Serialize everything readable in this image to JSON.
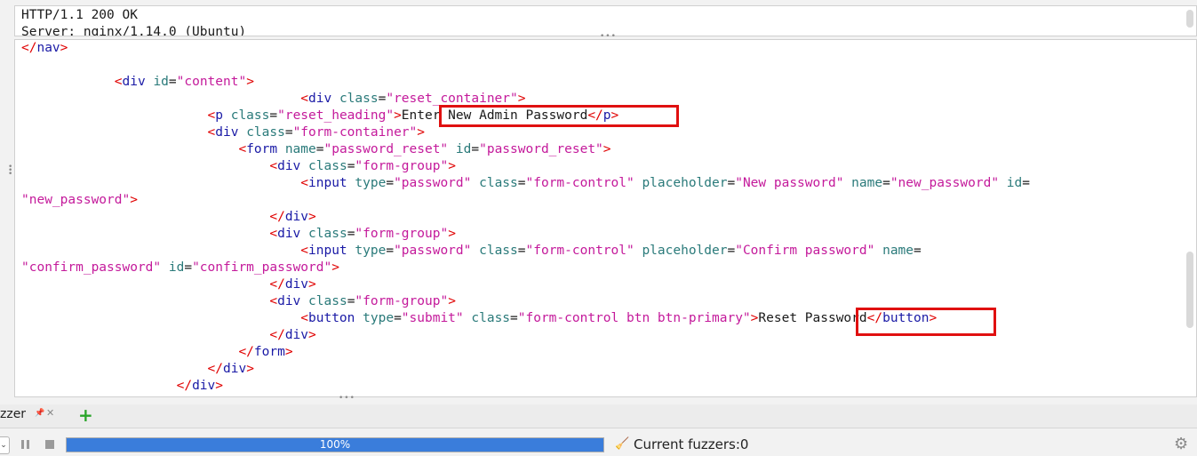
{
  "header": {
    "lines": [
      "HTTP/1.1 200 OK",
      "Server: nginx/1.14.0 (Ubuntu)"
    ]
  },
  "code": {
    "lines": [
      [
        [
          "bracket",
          "</"
        ],
        [
          "tag",
          "nav"
        ],
        [
          "bracket",
          ">"
        ]
      ],
      [],
      [
        [
          "txt",
          "            "
        ],
        [
          "bracket",
          "<"
        ],
        [
          "tag",
          "div"
        ],
        [
          "txt",
          " "
        ],
        [
          "attr",
          "id"
        ],
        [
          "txt",
          "="
        ],
        [
          "str",
          "\"content\""
        ],
        [
          "bracket",
          ">"
        ]
      ],
      [
        [
          "txt",
          "                                    "
        ],
        [
          "bracket",
          "<"
        ],
        [
          "tag",
          "div"
        ],
        [
          "txt",
          " "
        ],
        [
          "attr",
          "class"
        ],
        [
          "txt",
          "="
        ],
        [
          "str",
          "\"reset_container\""
        ],
        [
          "bracket",
          ">"
        ]
      ],
      [
        [
          "txt",
          "                        "
        ],
        [
          "bracket",
          "<"
        ],
        [
          "tag",
          "p"
        ],
        [
          "txt",
          " "
        ],
        [
          "attr",
          "class"
        ],
        [
          "txt",
          "="
        ],
        [
          "str",
          "\"reset_heading\""
        ],
        [
          "bracket",
          ">"
        ],
        [
          "txt",
          "Enter New Admin Password"
        ],
        [
          "bracket",
          "</"
        ],
        [
          "tag",
          "p"
        ],
        [
          "bracket",
          ">"
        ]
      ],
      [
        [
          "txt",
          "                        "
        ],
        [
          "bracket",
          "<"
        ],
        [
          "tag",
          "div"
        ],
        [
          "txt",
          " "
        ],
        [
          "attr",
          "class"
        ],
        [
          "txt",
          "="
        ],
        [
          "str",
          "\"form-container\""
        ],
        [
          "bracket",
          ">"
        ]
      ],
      [
        [
          "txt",
          "                            "
        ],
        [
          "bracket",
          "<"
        ],
        [
          "tag",
          "form"
        ],
        [
          "txt",
          " "
        ],
        [
          "attr",
          "name"
        ],
        [
          "txt",
          "="
        ],
        [
          "str",
          "\"password_reset\""
        ],
        [
          "txt",
          " "
        ],
        [
          "attr",
          "id"
        ],
        [
          "txt",
          "="
        ],
        [
          "str",
          "\"password_reset\""
        ],
        [
          "bracket",
          ">"
        ]
      ],
      [
        [
          "txt",
          "                                "
        ],
        [
          "bracket",
          "<"
        ],
        [
          "tag",
          "div"
        ],
        [
          "txt",
          " "
        ],
        [
          "attr",
          "class"
        ],
        [
          "txt",
          "="
        ],
        [
          "str",
          "\"form-group\""
        ],
        [
          "bracket",
          ">"
        ]
      ],
      [
        [
          "txt",
          "                                    "
        ],
        [
          "bracket",
          "<"
        ],
        [
          "tag",
          "input"
        ],
        [
          "txt",
          " "
        ],
        [
          "attr",
          "type"
        ],
        [
          "txt",
          "="
        ],
        [
          "str",
          "\"password\""
        ],
        [
          "txt",
          " "
        ],
        [
          "attr",
          "class"
        ],
        [
          "txt",
          "="
        ],
        [
          "str",
          "\"form-control\""
        ],
        [
          "txt",
          " "
        ],
        [
          "attr",
          "placeholder"
        ],
        [
          "txt",
          "="
        ],
        [
          "str",
          "\"New password\""
        ],
        [
          "txt",
          " "
        ],
        [
          "attr",
          "name"
        ],
        [
          "txt",
          "="
        ],
        [
          "str",
          "\"new_password\""
        ],
        [
          "txt",
          " "
        ],
        [
          "attr",
          "id"
        ],
        [
          "txt",
          "="
        ]
      ],
      [
        [
          "str",
          "\"new_password\""
        ],
        [
          "bracket",
          ">"
        ]
      ],
      [
        [
          "txt",
          "                                "
        ],
        [
          "bracket",
          "</"
        ],
        [
          "tag",
          "div"
        ],
        [
          "bracket",
          ">"
        ]
      ],
      [
        [
          "txt",
          "                                "
        ],
        [
          "bracket",
          "<"
        ],
        [
          "tag",
          "div"
        ],
        [
          "txt",
          " "
        ],
        [
          "attr",
          "class"
        ],
        [
          "txt",
          "="
        ],
        [
          "str",
          "\"form-group\""
        ],
        [
          "bracket",
          ">"
        ]
      ],
      [
        [
          "txt",
          "                                    "
        ],
        [
          "bracket",
          "<"
        ],
        [
          "tag",
          "input"
        ],
        [
          "txt",
          " "
        ],
        [
          "attr",
          "type"
        ],
        [
          "txt",
          "="
        ],
        [
          "str",
          "\"password\""
        ],
        [
          "txt",
          " "
        ],
        [
          "attr",
          "class"
        ],
        [
          "txt",
          "="
        ],
        [
          "str",
          "\"form-control\""
        ],
        [
          "txt",
          " "
        ],
        [
          "attr",
          "placeholder"
        ],
        [
          "txt",
          "="
        ],
        [
          "str",
          "\"Confirm password\""
        ],
        [
          "txt",
          " "
        ],
        [
          "attr",
          "name"
        ],
        [
          "txt",
          "="
        ]
      ],
      [
        [
          "str",
          "\"confirm_password\""
        ],
        [
          "txt",
          " "
        ],
        [
          "attr",
          "id"
        ],
        [
          "txt",
          "="
        ],
        [
          "str",
          "\"confirm_password\""
        ],
        [
          "bracket",
          ">"
        ]
      ],
      [
        [
          "txt",
          "                                "
        ],
        [
          "bracket",
          "</"
        ],
        [
          "tag",
          "div"
        ],
        [
          "bracket",
          ">"
        ]
      ],
      [
        [
          "txt",
          "                                "
        ],
        [
          "bracket",
          "<"
        ],
        [
          "tag",
          "div"
        ],
        [
          "txt",
          " "
        ],
        [
          "attr",
          "class"
        ],
        [
          "txt",
          "="
        ],
        [
          "str",
          "\"form-group\""
        ],
        [
          "bracket",
          ">"
        ]
      ],
      [
        [
          "txt",
          "                                    "
        ],
        [
          "bracket",
          "<"
        ],
        [
          "tag",
          "button"
        ],
        [
          "txt",
          " "
        ],
        [
          "attr",
          "type"
        ],
        [
          "txt",
          "="
        ],
        [
          "str",
          "\"submit\""
        ],
        [
          "txt",
          " "
        ],
        [
          "attr",
          "class"
        ],
        [
          "txt",
          "="
        ],
        [
          "str",
          "\"form-control btn btn-primary\""
        ],
        [
          "bracket",
          ">"
        ],
        [
          "txt",
          "Reset Password"
        ],
        [
          "bracket",
          "</"
        ],
        [
          "tag",
          "button"
        ],
        [
          "bracket",
          ">"
        ]
      ],
      [
        [
          "txt",
          "                                "
        ],
        [
          "bracket",
          "</"
        ],
        [
          "tag",
          "div"
        ],
        [
          "bracket",
          ">"
        ]
      ],
      [
        [
          "txt",
          "                            "
        ],
        [
          "bracket",
          "</"
        ],
        [
          "tag",
          "form"
        ],
        [
          "bracket",
          ">"
        ]
      ],
      [
        [
          "txt",
          "                        "
        ],
        [
          "bracket",
          "</"
        ],
        [
          "tag",
          "div"
        ],
        [
          "bracket",
          ">"
        ]
      ],
      [
        [
          "txt",
          "                    "
        ],
        [
          "bracket",
          "</"
        ],
        [
          "tag",
          "div"
        ],
        [
          "bracket",
          ">"
        ]
      ]
    ]
  },
  "tabs": {
    "fuzzer_label": "zzer",
    "pin_icon": "pin-icon",
    "close_icon": "close-icon",
    "add_icon": "add-tab-icon"
  },
  "status": {
    "progress_fraction": 1.0,
    "progress_text": "100%",
    "fuzzers_label": "Current fuzzers:0",
    "progress_color": "#3a7ddb"
  }
}
